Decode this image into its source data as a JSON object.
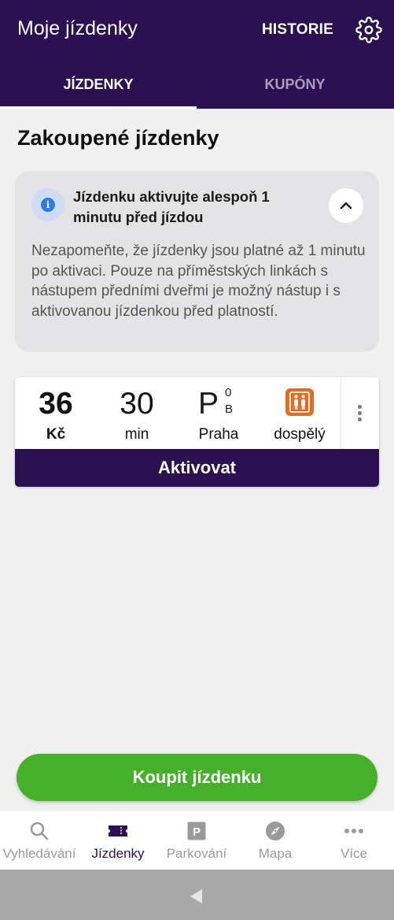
{
  "appbar": {
    "title": "Moje jízdenky",
    "history_label": "HISTORIE",
    "settings_icon": "gear-icon",
    "background": "#2b1152"
  },
  "tabs": [
    {
      "label": "JÍZDENKY",
      "active": true
    },
    {
      "label": "KUPÓNY",
      "active": false
    }
  ],
  "section_title": "Zakoupené jízdenky",
  "info_card": {
    "icon": "info-icon",
    "title": "Jízdenku aktivujte alespoň 1 minutu před jízdou",
    "body": "Nezapomeňte, že jízdenky jsou platné až 1 minutu po aktivaci. Pouze na příměstských linkách s nástupem předními dveřmi je možný nástup i s aktivovanou jízdenkou před platností.",
    "collapse_icon": "chevron-up-icon"
  },
  "ticket": {
    "price_value": "36",
    "price_unit": "Kč",
    "duration_value": "30",
    "duration_unit": "min",
    "zone_letter": "P",
    "zone_sup": "0",
    "zone_sub": "B",
    "zone_label": "Praha",
    "passenger_icon": "adult-icon",
    "passenger_label": "dospělý",
    "menu_icon": "more-vertical-icon",
    "activate_label": "Aktivovat"
  },
  "buy_button": {
    "label": "Koupit jízdenku",
    "color": "#45b029"
  },
  "bottom_nav": [
    {
      "label": "Vyhledávání",
      "icon": "search-icon",
      "active": false
    },
    {
      "label": "Jízdenky",
      "icon": "ticket-icon",
      "active": true
    },
    {
      "label": "Parkování",
      "icon": "parking-icon",
      "active": false
    },
    {
      "label": "Mapa",
      "icon": "compass-icon",
      "active": false
    },
    {
      "label": "Více",
      "icon": "more-horizontal-icon",
      "active": false
    }
  ]
}
